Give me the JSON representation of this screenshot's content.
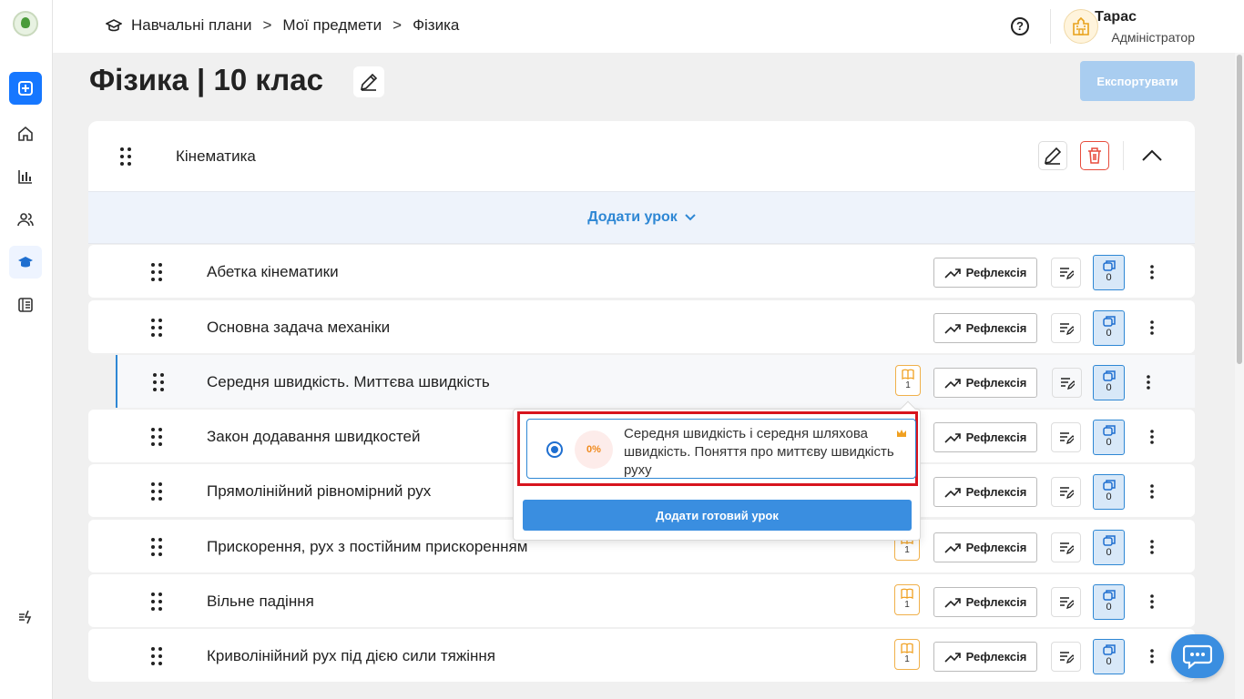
{
  "breadcrumbs": [
    "Навчальні плани",
    "Мої предмети",
    "Фізика"
  ],
  "breadcrumb_sep": ">",
  "user": {
    "name": "Тарас",
    "role": "Адміністратор"
  },
  "help_label": "?",
  "page_title": "Фізика | 10 клас",
  "export_label": "Експортувати",
  "module": {
    "title": "Кінематика"
  },
  "add_lesson_label": "Додати урок",
  "reflection_label": "Рефлексія",
  "lessons": [
    {
      "title": "Абетка кінематики",
      "copies": "0"
    },
    {
      "title": "Основна задача механіки",
      "copies": "0"
    },
    {
      "title": "Середня швидкість. Миттєва швидкість",
      "books": "1",
      "copies": "0"
    },
    {
      "title": "Закон додавання швидкостей",
      "copies": "0"
    },
    {
      "title": "Прямолінійний рівномірний рух",
      "copies": "0"
    },
    {
      "title": "Прискорення, рух з постійним прискоренням",
      "books": "1",
      "copies": "0"
    },
    {
      "title": "Вільне падіння",
      "books": "1",
      "copies": "0"
    },
    {
      "title": "Криволінійний рух під дією сили тяжіння",
      "books": "1",
      "copies": "0"
    }
  ],
  "popup": {
    "progress": "0%",
    "lesson_title": "Середня швидкість і середня шляхова швидкість. Поняття про миттєву швидкість руху",
    "add_button": "Додати готовий урок"
  },
  "colors": {
    "accent": "#2e87d4",
    "danger": "#e74c3c",
    "book": "#f0b04a",
    "highlight": "#d7141e"
  }
}
